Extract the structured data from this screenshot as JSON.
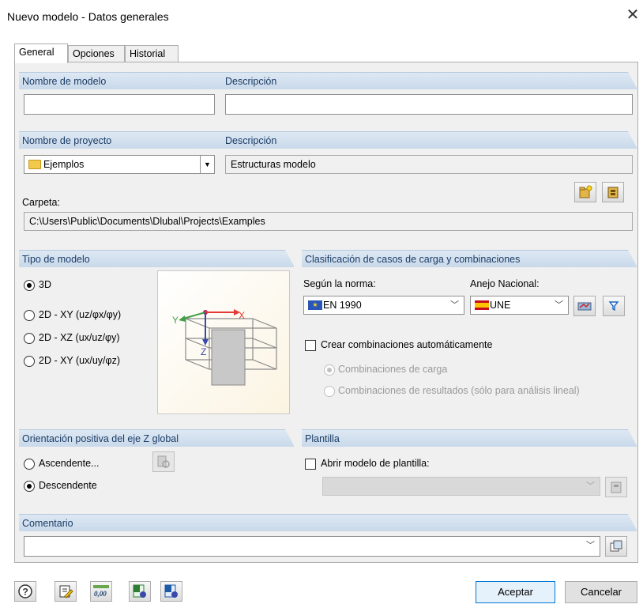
{
  "window": {
    "title": "Nuevo modelo - Datos generales"
  },
  "tabs": [
    {
      "label": "General"
    },
    {
      "label": "Opciones"
    },
    {
      "label": "Historial"
    }
  ],
  "model": {
    "name_label": "Nombre de modelo",
    "desc_label": "Descripción",
    "name_value": "",
    "desc_value": ""
  },
  "project": {
    "name_label": "Nombre de proyecto",
    "desc_label": "Descripción",
    "selected": "Ejemplos",
    "description": "Estructuras modelo",
    "folder_label": "Carpeta:",
    "folder_path": "C:\\Users\\Public\\Documents\\Dlubal\\Projects\\Examples"
  },
  "model_type": {
    "title": "Tipo de modelo",
    "options": [
      {
        "label": "3D",
        "selected": true
      },
      {
        "label": "2D - XY (uz/φx/φy)",
        "selected": false
      },
      {
        "label": "2D - XZ (ux/uz/φy)",
        "selected": false
      },
      {
        "label": "2D - XY (ux/uy/φz)",
        "selected": false
      }
    ],
    "axis_labels": {
      "x": "X",
      "y": "Y",
      "z": "Z"
    }
  },
  "classification": {
    "title": "Clasificación de casos de carga y combinaciones",
    "norm_label": "Según la norma:",
    "norm_value": "EN 1990",
    "annex_label": "Anejo Nacional:",
    "annex_value": "UNE",
    "auto_label": "Crear combinaciones automáticamente",
    "auto_checked": false,
    "sub_options": [
      {
        "label": "Combinaciones de carga",
        "selected": true
      },
      {
        "label": "Combinaciones de resultados (sólo para análisis lineal)",
        "selected": false
      }
    ]
  },
  "orientation": {
    "title": "Orientación positiva del eje Z global",
    "options": [
      {
        "label": "Ascendente...",
        "selected": false
      },
      {
        "label": "Descendente",
        "selected": true
      }
    ]
  },
  "template": {
    "title": "Plantilla",
    "open_label": "Abrir modelo de plantilla:",
    "checked": false,
    "value": ""
  },
  "comment": {
    "title": "Comentario",
    "value": ""
  },
  "footer": {
    "ok_label": "Aceptar",
    "cancel_label": "Cancelar",
    "units_text": "0,00"
  },
  "colors": {
    "group_header": "#c9d9ea",
    "group_title": "#1b3c66",
    "accent": "#0078d7"
  }
}
